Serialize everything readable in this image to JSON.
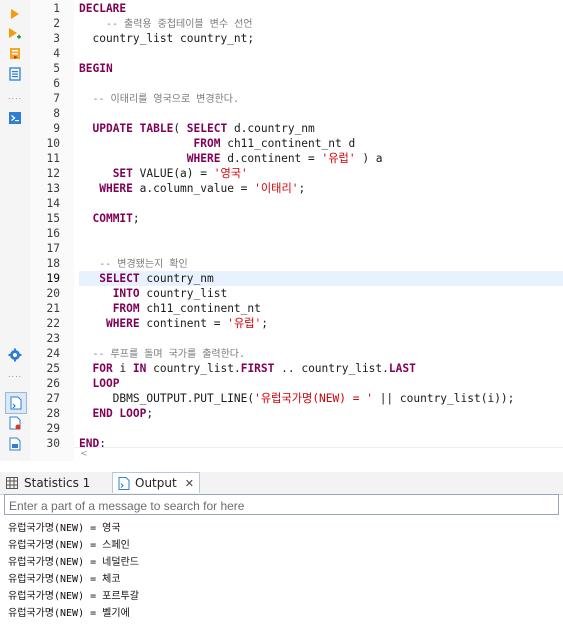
{
  "toolbar": {
    "buttons": [
      "run-icon",
      "run-current-icon",
      "explain-plan-icon",
      "format-icon",
      "console-icon",
      "settings-icon",
      "output-panel-icon",
      "log-panel-icon",
      "text-panel-icon"
    ]
  },
  "editor": {
    "current_line": 19,
    "lines": [
      {
        "n": "1",
        "segs": [
          [
            "kw",
            "DECLARE"
          ]
        ]
      },
      {
        "n": "2",
        "segs": [
          [
            "id",
            "    "
          ],
          [
            "cm",
            "-- 출력용 중첩테이블 변수 선언"
          ]
        ]
      },
      {
        "n": "3",
        "segs": [
          [
            "id",
            "  country_list country_nt;"
          ]
        ]
      },
      {
        "n": "4",
        "segs": []
      },
      {
        "n": "5",
        "segs": [
          [
            "kw",
            "BEGIN"
          ]
        ]
      },
      {
        "n": "6",
        "segs": []
      },
      {
        "n": "7",
        "segs": [
          [
            "id",
            "  "
          ],
          [
            "cm",
            "-- 이태리를 영국으로 변경한다."
          ]
        ]
      },
      {
        "n": "8",
        "segs": []
      },
      {
        "n": "9",
        "segs": [
          [
            "id",
            "  "
          ],
          [
            "kw",
            "UPDATE TABLE"
          ],
          [
            "id",
            "( "
          ],
          [
            "kw",
            "SELECT"
          ],
          [
            "id",
            " d.country_nm"
          ]
        ]
      },
      {
        "n": "10",
        "segs": [
          [
            "id",
            "                 "
          ],
          [
            "kw",
            "FROM"
          ],
          [
            "id",
            " ch11_continent_nt d"
          ]
        ]
      },
      {
        "n": "11",
        "segs": [
          [
            "id",
            "                "
          ],
          [
            "kw",
            "WHERE"
          ],
          [
            "id",
            " d.continent = "
          ],
          [
            "st",
            "'유럽'"
          ],
          [
            "id",
            " ) a"
          ]
        ]
      },
      {
        "n": "12",
        "segs": [
          [
            "id",
            "     "
          ],
          [
            "kw",
            "SET"
          ],
          [
            "id",
            " VALUE(a) = "
          ],
          [
            "st",
            "'영국'"
          ]
        ]
      },
      {
        "n": "13",
        "segs": [
          [
            "id",
            "   "
          ],
          [
            "kw",
            "WHERE"
          ],
          [
            "id",
            " a.column_value = "
          ],
          [
            "st",
            "'이태리'"
          ],
          [
            "id",
            ";"
          ]
        ]
      },
      {
        "n": "14",
        "segs": []
      },
      {
        "n": "15",
        "segs": [
          [
            "id",
            "  "
          ],
          [
            "kw",
            "COMMIT"
          ],
          [
            "id",
            ";"
          ]
        ]
      },
      {
        "n": "16",
        "segs": []
      },
      {
        "n": "17",
        "segs": []
      },
      {
        "n": "18",
        "segs": [
          [
            "id",
            "   "
          ],
          [
            "cm",
            "-- 변경됐는지 확인"
          ]
        ]
      },
      {
        "n": "19",
        "segs": [
          [
            "id",
            "   "
          ],
          [
            "kw",
            "SELECT"
          ],
          [
            "id",
            " country_nm"
          ]
        ]
      },
      {
        "n": "20",
        "segs": [
          [
            "id",
            "     "
          ],
          [
            "kw",
            "INTO"
          ],
          [
            "id",
            " country_list"
          ]
        ]
      },
      {
        "n": "21",
        "segs": [
          [
            "id",
            "     "
          ],
          [
            "kw",
            "FROM"
          ],
          [
            "id",
            " ch11_continent_nt"
          ]
        ]
      },
      {
        "n": "22",
        "segs": [
          [
            "id",
            "    "
          ],
          [
            "kw",
            "WHERE"
          ],
          [
            "id",
            " continent = "
          ],
          [
            "st",
            "'유럽'"
          ],
          [
            "id",
            ";"
          ]
        ]
      },
      {
        "n": "23",
        "segs": []
      },
      {
        "n": "24",
        "segs": [
          [
            "id",
            "  "
          ],
          [
            "cm",
            "-- 루프를 돌며 국가를 출력한다."
          ]
        ]
      },
      {
        "n": "25",
        "segs": [
          [
            "id",
            "  "
          ],
          [
            "kw",
            "FOR"
          ],
          [
            "id",
            " i "
          ],
          [
            "kw",
            "IN"
          ],
          [
            "id",
            " country_list."
          ],
          [
            "kw",
            "FIRST"
          ],
          [
            "id",
            " .. country_list."
          ],
          [
            "kw",
            "LAST"
          ]
        ]
      },
      {
        "n": "26",
        "segs": [
          [
            "id",
            "  "
          ],
          [
            "kw",
            "LOOP"
          ]
        ]
      },
      {
        "n": "27",
        "segs": [
          [
            "id",
            "     DBMS_OUTPUT.PUT_LINE("
          ],
          [
            "st",
            "'유럽국가명(NEW) = '"
          ],
          [
            "id",
            " || country_list(i));"
          ]
        ]
      },
      {
        "n": "28",
        "segs": [
          [
            "id",
            "  "
          ],
          [
            "kw",
            "END LOOP"
          ],
          [
            "id",
            ";"
          ]
        ]
      },
      {
        "n": "29",
        "segs": []
      },
      {
        "n": "30",
        "segs": [
          [
            "kw",
            "END"
          ],
          [
            "id",
            ":"
          ]
        ]
      }
    ]
  },
  "tabs": {
    "statistics_label": "Statistics 1",
    "output_label": "Output",
    "close_glyph": "✕"
  },
  "search": {
    "placeholder": "Enter a part of a message to search for here",
    "value": ""
  },
  "output": {
    "lines": [
      "유럽국가명(NEW) = 영국",
      "유럽국가명(NEW) = 스페인",
      "유럽국가명(NEW) = 네덜란드",
      "유럽국가명(NEW) = 체코",
      "유럽국가명(NEW) = 포르투갈",
      "유럽국가명(NEW) = 벨기에"
    ]
  }
}
